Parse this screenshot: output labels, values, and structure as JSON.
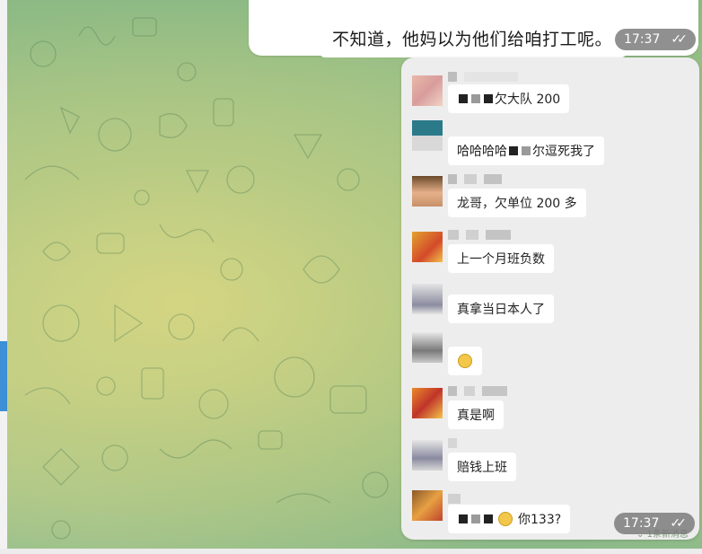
{
  "outgoing": {
    "text": "不知道，他妈以为他们给咱打工呢。",
    "time": "17:37",
    "status": "read"
  },
  "screenshot": {
    "messages": [
      {
        "text_left": "",
        "text_right": "欠大队 200",
        "avatar": "avatar-1"
      },
      {
        "text_left": "哈哈哈哈",
        "text_right": "尔逗死我了",
        "avatar": "avatar-2"
      },
      {
        "text_left": "龙哥，欠单位 200 多",
        "text_right": "",
        "avatar": "avatar-3"
      },
      {
        "text_left": "上一个月班负数",
        "text_right": "",
        "avatar": "avatar-4"
      },
      {
        "text_left": "真拿当日本人了",
        "text_right": "",
        "avatar": "avatar-5"
      },
      {
        "text_left": "",
        "text_right": "",
        "avatar": "avatar-6",
        "emoji": "grimace-emoji"
      },
      {
        "text_left": "真是啊",
        "text_right": "",
        "avatar": "avatar-7"
      },
      {
        "text_left": "赔钱上班",
        "text_right": "",
        "avatar": "avatar-8"
      },
      {
        "text_left": "",
        "text_right": "你133?",
        "avatar": "avatar-9",
        "emoji": "sunglasses-emoji"
      }
    ],
    "time": "17:37",
    "new_messages_label": "1条新消息"
  },
  "colors": {
    "left_accent": "#3d8fd6",
    "time_pill": "#7a7a7a"
  }
}
